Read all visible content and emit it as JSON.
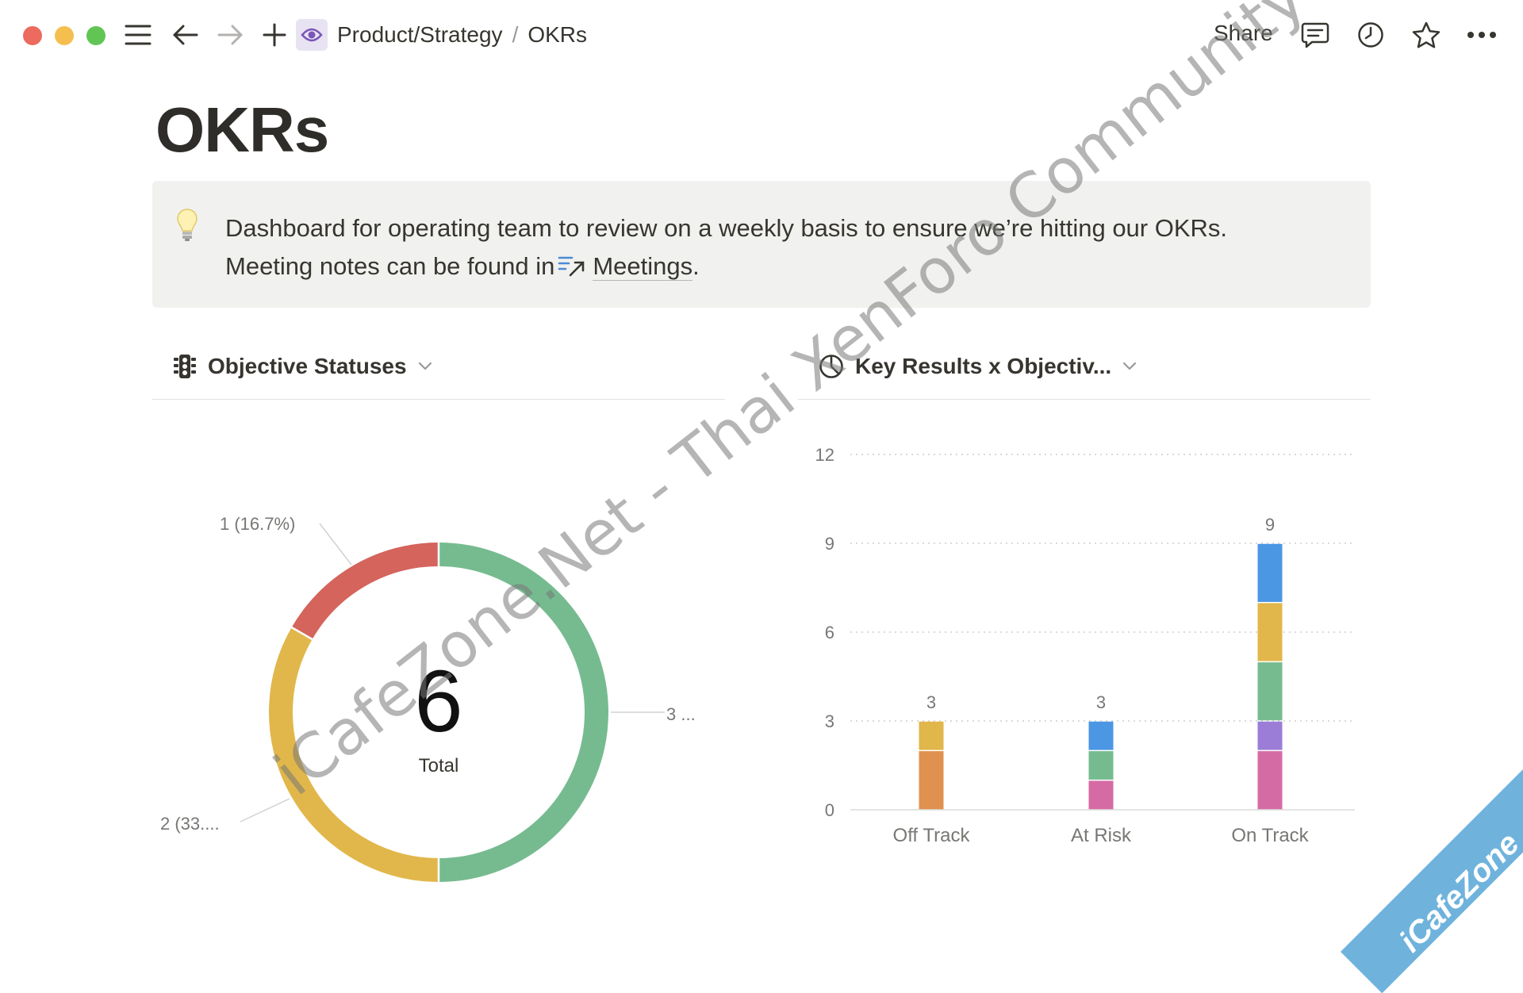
{
  "topbar": {
    "breadcrumb_parent": "Product/Strategy",
    "breadcrumb_sep": "/",
    "breadcrumb_current": "OKRs",
    "share_label": "Share",
    "icons": [
      "menu-icon",
      "back-arrow-icon",
      "forward-arrow-icon",
      "plus-icon",
      "eye-icon",
      "comment-icon",
      "clock-icon",
      "star-icon",
      "more-icon"
    ]
  },
  "page": {
    "title": "OKRs",
    "callout_line1": "Dashboard for operating team to review on a weekly basis to ensure we’re hitting our OKRs.",
    "callout_line2_prefix": "Meeting notes can be found in",
    "callout_link": "Meetings",
    "callout_suffix": "."
  },
  "charts_header": {
    "left_title": "Objective Statuses",
    "right_title": "Key Results x Objectiv..."
  },
  "chart_data": [
    {
      "type": "pie",
      "title": "Objective Statuses",
      "center_value": "6",
      "center_label": "Total",
      "slices": [
        {
          "value": 3,
          "color": "#76bb8f",
          "label": "3 ..."
        },
        {
          "value": 2,
          "color": "#e1b74b",
          "label": "2 (33...."
        },
        {
          "value": 1,
          "color": "#d4645c",
          "label": "1 (16.7%)"
        }
      ]
    },
    {
      "type": "bar",
      "title": "Key Results x Objectiv...",
      "stacked": true,
      "categories": [
        "Off Track",
        "At Risk",
        "On Track"
      ],
      "totals": [
        3,
        3,
        9
      ],
      "ylim": [
        0,
        12
      ],
      "yticks": [
        0,
        3,
        6,
        9,
        12
      ],
      "grid": true,
      "segments": [
        [
          {
            "value": 2,
            "color": "#e0904f"
          },
          {
            "value": 1,
            "color": "#e1b74b"
          }
        ],
        [
          {
            "value": 1,
            "color": "#d56ba5"
          },
          {
            "value": 1,
            "color": "#76bb8f"
          },
          {
            "value": 1,
            "color": "#4b97e4"
          }
        ],
        [
          {
            "value": 2,
            "color": "#d56ba5"
          },
          {
            "value": 1,
            "color": "#9b7dd8"
          },
          {
            "value": 2,
            "color": "#76bb8f"
          },
          {
            "value": 2,
            "color": "#e1b74b"
          },
          {
            "value": 2,
            "color": "#4b97e4"
          }
        ]
      ]
    }
  ],
  "watermark": {
    "diagonal_text": "iCafeZone.Net - Thai XenForo Community",
    "corner_text": "iCafeZone"
  }
}
